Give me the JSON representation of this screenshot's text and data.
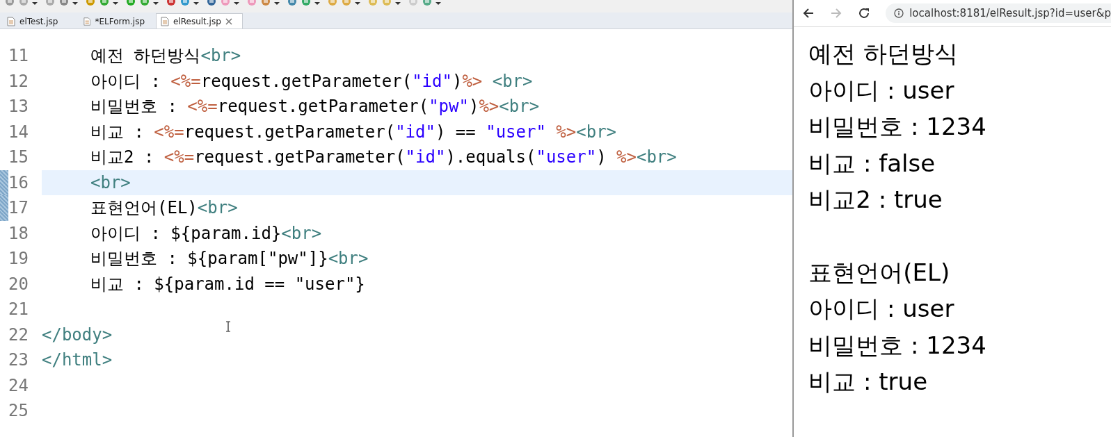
{
  "tabs": [
    {
      "label": "elTest.jsp",
      "selected": false,
      "closable": false
    },
    {
      "label": "*ELForm.jsp",
      "selected": false,
      "closable": false
    },
    {
      "label": "elResult.jsp",
      "selected": true,
      "closable": true
    }
  ],
  "editor": {
    "lines": [
      {
        "number": "11",
        "indented": true,
        "current": false,
        "changed": false,
        "tokens": [
          {
            "kind": "text",
            "text": "예전 하던방식"
          },
          {
            "kind": "tag",
            "text": "<br>"
          }
        ]
      },
      {
        "number": "12",
        "indented": true,
        "current": false,
        "changed": false,
        "tokens": [
          {
            "kind": "text",
            "text": "아이디 : "
          },
          {
            "kind": "jsp",
            "text": "<%="
          },
          {
            "kind": "text",
            "text": "request.getParameter("
          },
          {
            "kind": "string",
            "text": "\"id\""
          },
          {
            "kind": "text",
            "text": ")"
          },
          {
            "kind": "jsp",
            "text": "%>"
          },
          {
            "kind": "tag",
            "text": " <br>"
          }
        ]
      },
      {
        "number": "13",
        "indented": true,
        "current": false,
        "changed": false,
        "tokens": [
          {
            "kind": "text",
            "text": "비밀번호 : "
          },
          {
            "kind": "jsp",
            "text": "<%="
          },
          {
            "kind": "text",
            "text": "request.getParameter("
          },
          {
            "kind": "string",
            "text": "\"pw\""
          },
          {
            "kind": "text",
            "text": ")"
          },
          {
            "kind": "jsp",
            "text": "%>"
          },
          {
            "kind": "tag",
            "text": "<br>"
          }
        ]
      },
      {
        "number": "14",
        "indented": true,
        "current": false,
        "changed": false,
        "tokens": [
          {
            "kind": "text",
            "text": "비교 : "
          },
          {
            "kind": "jsp",
            "text": "<%="
          },
          {
            "kind": "text",
            "text": "request.getParameter("
          },
          {
            "kind": "string",
            "text": "\"id\""
          },
          {
            "kind": "text",
            "text": ") == "
          },
          {
            "kind": "string",
            "text": "\"user\""
          },
          {
            "kind": "jsp",
            "text": " %>"
          },
          {
            "kind": "tag",
            "text": "<br>"
          }
        ]
      },
      {
        "number": "15",
        "indented": true,
        "current": false,
        "changed": false,
        "tokens": [
          {
            "kind": "text",
            "text": "비교2 : "
          },
          {
            "kind": "jsp",
            "text": "<%="
          },
          {
            "kind": "text",
            "text": "request.getParameter("
          },
          {
            "kind": "string",
            "text": "\"id\""
          },
          {
            "kind": "text",
            "text": ").equals("
          },
          {
            "kind": "string",
            "text": "\"user\""
          },
          {
            "kind": "text",
            "text": ") "
          },
          {
            "kind": "jsp",
            "text": "%>"
          },
          {
            "kind": "tag",
            "text": "<br>"
          }
        ]
      },
      {
        "number": "16",
        "indented": true,
        "current": true,
        "changed": true,
        "tokens": [
          {
            "kind": "tag",
            "text": "<br>"
          }
        ]
      },
      {
        "number": "17",
        "indented": true,
        "current": false,
        "changed": true,
        "tokens": [
          {
            "kind": "text",
            "text": "표현언어(EL)"
          },
          {
            "kind": "tag",
            "text": "<br>"
          }
        ]
      },
      {
        "number": "18",
        "indented": true,
        "current": false,
        "changed": false,
        "tokens": [
          {
            "kind": "text",
            "text": "아이디 : ${param.id}"
          },
          {
            "kind": "tag",
            "text": "<br>"
          }
        ]
      },
      {
        "number": "19",
        "indented": true,
        "current": false,
        "changed": false,
        "tokens": [
          {
            "kind": "text",
            "text": "비밀번호 : ${param[\"pw\"]}"
          },
          {
            "kind": "tag",
            "text": "<br>"
          }
        ]
      },
      {
        "number": "20",
        "indented": true,
        "current": false,
        "changed": false,
        "tokens": [
          {
            "kind": "text",
            "text": "비교 : ${param.id == \"user\"}"
          }
        ]
      },
      {
        "number": "21",
        "current": false,
        "changed": false
      },
      {
        "number": "22",
        "indented": false,
        "current": false,
        "changed": false,
        "tokens": [
          {
            "kind": "tag",
            "text": "</body>"
          }
        ]
      },
      {
        "number": "23",
        "indented": false,
        "current": false,
        "changed": false,
        "tokens": [
          {
            "kind": "tag",
            "text": "</html>"
          }
        ]
      },
      {
        "number": "24",
        "current": false,
        "changed": false
      },
      {
        "number": "25",
        "current": false,
        "changed": false
      }
    ]
  },
  "browser": {
    "forward_disabled": true,
    "url": "localhost:8181/elResult.jsp?id=user&p",
    "output_blocks": [
      [
        "예전 하던방식",
        "아이디 : user",
        "비밀번호 : 1234",
        "비교 : false",
        "비교2 : true"
      ],
      [
        "표현언어(EL)",
        "아이디 : user",
        "비밀번호 : 1234",
        "비교 : true"
      ]
    ]
  }
}
